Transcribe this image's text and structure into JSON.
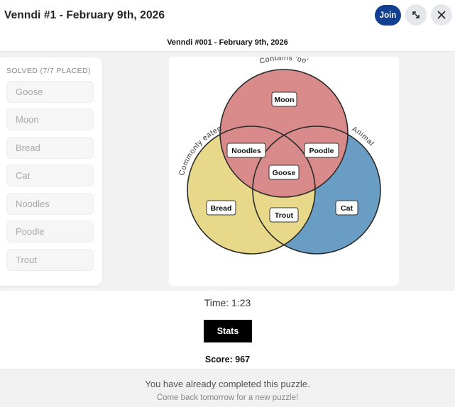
{
  "header": {
    "title": "Venndi #1 - February 9th, 2026",
    "join_label": "Join",
    "expand_icon": "expand-icon",
    "close_icon": "close-icon"
  },
  "puzzle_title": "Venndi #001 - February 9th, 2026",
  "sidebar": {
    "header": "SOLVED (7/7 PLACED)",
    "items": [
      "Goose",
      "Moon",
      "Bread",
      "Cat",
      "Noodles",
      "Poodle",
      "Trout"
    ]
  },
  "venn": {
    "circles": [
      {
        "label": "Contains 'oo'",
        "color": "#cc4c4c"
      },
      {
        "label": "Commonly eaten",
        "color": "#dcc74c"
      },
      {
        "label": "Animal",
        "color": "#3f84b8"
      }
    ],
    "placements": {
      "contains_oo_only": "Moon",
      "eaten_only": "Bread",
      "animal_only": "Cat",
      "oo_and_eaten": "Noodles",
      "oo_and_animal": "Poodle",
      "eaten_and_animal": "Trout",
      "all_three": "Goose"
    }
  },
  "result": {
    "time": "Time: 1:23",
    "stats_label": "Stats",
    "score": "Score: 967"
  },
  "completed": {
    "title": "You have already completed this puzzle.",
    "subtitle": "Come back tomorrow for a new puzzle!"
  }
}
